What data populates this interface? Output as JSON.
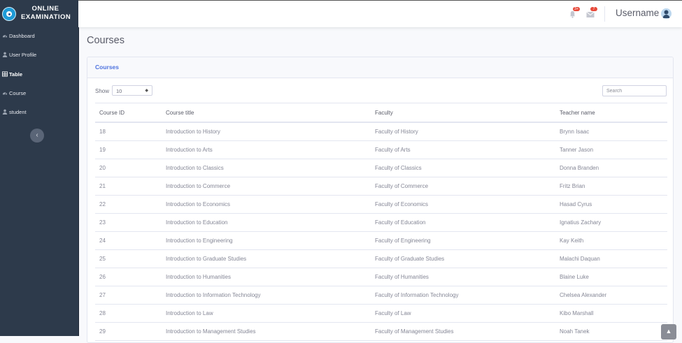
{
  "brand": {
    "line1": "ONLINE",
    "line2": "EXAMINATION"
  },
  "sidebar": {
    "items": [
      {
        "label": "Dashboard",
        "icon": "dashboard-icon",
        "active": false
      },
      {
        "label": "User Profile",
        "icon": "user-icon",
        "active": false
      },
      {
        "label": "Table",
        "icon": "table-icon",
        "active": true
      },
      {
        "label": "Course",
        "icon": "course-icon",
        "active": false
      },
      {
        "label": "student",
        "icon": "student-icon",
        "active": false
      }
    ],
    "toggle_glyph": "‹"
  },
  "topbar": {
    "alerts_badge": "3+",
    "messages_badge": "7",
    "username": "Username"
  },
  "page": {
    "title": "Courses"
  },
  "card": {
    "header": "Courses",
    "show_label": "Show",
    "show_value": "10",
    "search_placeholder": "Search",
    "columns": [
      "Course ID",
      "Course title",
      "Faculty",
      "Teacher name"
    ],
    "rows": [
      [
        "18",
        "Introduction to History",
        "Faculty of History",
        "Brynn Isaac"
      ],
      [
        "19",
        "Introduction to Arts",
        "Faculty of Arts",
        "Tanner Jason"
      ],
      [
        "20",
        "Introduction to Classics",
        "Faculty of Classics",
        "Donna Branden"
      ],
      [
        "21",
        "Introduction to Commerce",
        "Faculty of Commerce",
        "Fritz Brian"
      ],
      [
        "22",
        "Introduction to Economics",
        "Faculty of Economics",
        "Hasad Cyrus"
      ],
      [
        "23",
        "Introduction to Education",
        "Faculty of Education",
        "Ignatius Zachary"
      ],
      [
        "24",
        "Introduction to Engineering",
        "Faculty of Engineering",
        "Kay Keith"
      ],
      [
        "25",
        "Introduction to Graduate Studies",
        "Faculty of Graduate Studies",
        "Malachi Daquan"
      ],
      [
        "26",
        "Introduction to Humanities",
        "Faculty of Humanities",
        "Blaine Luke"
      ],
      [
        "27",
        "Introduction to Information Technology",
        "Faculty of Information Technology",
        "Chelsea Alexander"
      ],
      [
        "28",
        "Introduction to Law",
        "Faculty of Law",
        "Kibo Marshall"
      ],
      [
        "29",
        "Introduction to Management Studies",
        "Faculty of Management Studies",
        "Noah Tanek"
      ]
    ]
  },
  "colors": {
    "sidebar_bg": "#2d3a4b",
    "accent": "#4e73df",
    "badge": "#e74a3b"
  }
}
